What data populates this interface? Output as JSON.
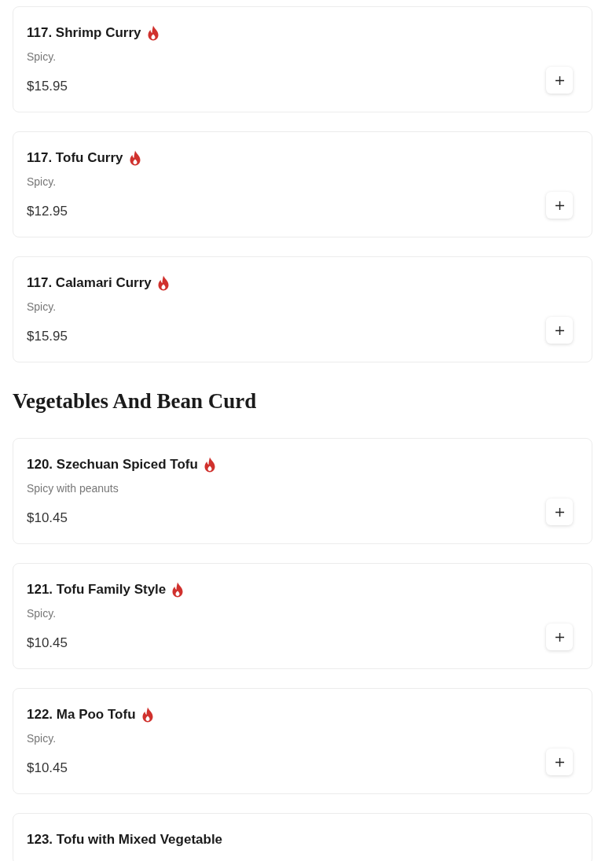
{
  "sections": [
    {
      "items": [
        {
          "name": "117. Shrimp Curry",
          "spicy": true,
          "description": "Spicy.",
          "price": "$15.95"
        },
        {
          "name": "117. Tofu Curry",
          "spicy": true,
          "description": "Spicy.",
          "price": "$12.95"
        },
        {
          "name": "117. Calamari Curry",
          "spicy": true,
          "description": "Spicy.",
          "price": "$15.95"
        }
      ]
    },
    {
      "title": "Vegetables And Bean Curd",
      "items": [
        {
          "name": "120. Szechuan Spiced Tofu",
          "spicy": true,
          "description": "Spicy with peanuts",
          "price": "$10.45"
        },
        {
          "name": "121. Tofu Family Style",
          "spicy": true,
          "description": "Spicy.",
          "price": "$10.45"
        },
        {
          "name": "122. Ma Poo Tofu",
          "spicy": true,
          "description": "Spicy.",
          "price": "$10.45"
        },
        {
          "name": "123. Tofu with Mixed Vegetable",
          "spicy": false
        }
      ]
    }
  ]
}
